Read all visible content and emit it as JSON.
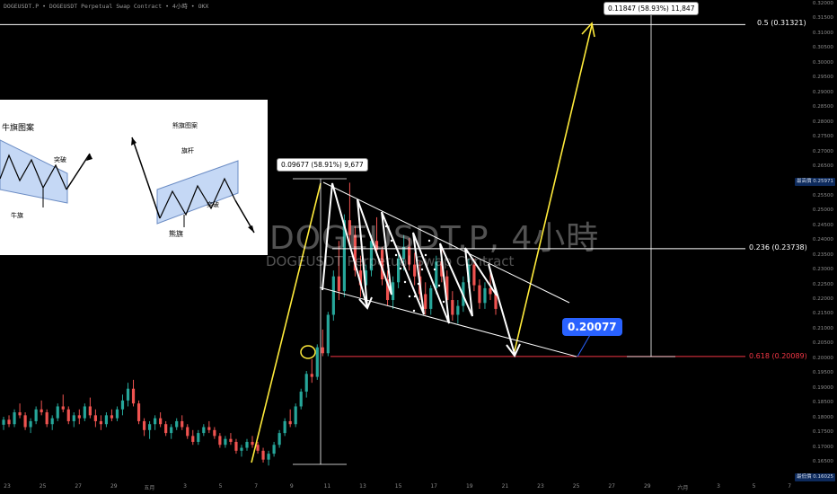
{
  "header": {
    "symbol": "DOGEUSDT.P",
    "contract": "DOGEUSDT Perpetual Swap Contract",
    "interval": "4小時",
    "exchange": "OKX",
    "separator": "•"
  },
  "watermark": {
    "line1": "DOGEUSDT.P, 4小時",
    "line2": "DOGEUSDT Perpetual Swap Contract"
  },
  "price_axis": {
    "ticks": [
      "0.32000",
      "0.31500",
      "0.31000",
      "0.30500",
      "0.30000",
      "0.29500",
      "0.29000",
      "0.28500",
      "0.28000",
      "0.27500",
      "0.27000",
      "0.26500",
      "0.26000",
      "0.25500",
      "0.25000",
      "0.24500",
      "0.24000",
      "0.23500",
      "0.23000",
      "0.22500",
      "0.22000",
      "0.21500",
      "0.21000",
      "0.20500",
      "0.20000",
      "0.19500",
      "0.19000",
      "0.18500",
      "0.18000",
      "0.17500",
      "0.17000",
      "0.16500"
    ],
    "high_badge": {
      "label": "最高價",
      "value": "0.25971"
    },
    "low_badge": {
      "label": "最低價",
      "value": "0.16025"
    }
  },
  "time_axis": {
    "ticks": [
      "23",
      "25",
      "27",
      "29",
      "五月",
      "3",
      "5",
      "7",
      "9",
      "11",
      "13",
      "15",
      "17",
      "19",
      "21",
      "23",
      "25",
      "27",
      "29",
      "六月",
      "3",
      "5",
      "7"
    ]
  },
  "fib_levels": [
    {
      "label": "0.5 (0.31321)",
      "price": 0.31321,
      "color": "#ffffff"
    },
    {
      "label": "0.236 (0.23738)",
      "price": 0.23738,
      "color": "#ffffff"
    },
    {
      "label": "0.618 (0.20089)",
      "price": 0.20089,
      "color": "#f23645"
    }
  ],
  "measurements": [
    {
      "text": "0.09677 (58.91%) 9,677"
    },
    {
      "text": "0.11847 (58.93%) 11,847"
    }
  ],
  "callout": {
    "text": "0.20077"
  },
  "inset": {
    "bull_title": "牛旗图案",
    "bear_title": "熊旗图案",
    "breakout_left": "突破",
    "bull_flag": "牛旗",
    "flagpole": "旗杆",
    "breakout_right": "突破",
    "bear_flag": "熊旗"
  },
  "colors": {
    "up": "#26a69a",
    "down": "#ef5350",
    "annotation": "#ffeb3b",
    "fib_red": "#f23645",
    "callout": "#2962ff"
  },
  "chart_data": {
    "type": "candlestick",
    "symbol": "DOGEUSDT.P",
    "timeframe": "4小時",
    "price_range": [
      0.16,
      0.32
    ],
    "candles_ohlc_approx": [
      [
        0.1778,
        0.1805,
        0.176,
        0.1795
      ],
      [
        0.1795,
        0.181,
        0.177,
        0.178
      ],
      [
        0.178,
        0.183,
        0.177,
        0.182
      ],
      [
        0.182,
        0.185,
        0.18,
        0.181
      ],
      [
        0.181,
        0.182,
        0.176,
        0.177
      ],
      [
        0.177,
        0.18,
        0.175,
        0.179
      ],
      [
        0.179,
        0.184,
        0.178,
        0.183
      ],
      [
        0.183,
        0.186,
        0.181,
        0.182
      ],
      [
        0.182,
        0.183,
        0.177,
        0.178
      ],
      [
        0.178,
        0.181,
        0.176,
        0.18
      ],
      [
        0.18,
        0.185,
        0.179,
        0.184
      ],
      [
        0.184,
        0.188,
        0.182,
        0.183
      ],
      [
        0.183,
        0.184,
        0.178,
        0.179
      ],
      [
        0.179,
        0.182,
        0.177,
        0.181
      ],
      [
        0.181,
        0.183,
        0.178,
        0.18
      ],
      [
        0.18,
        0.185,
        0.179,
        0.184
      ],
      [
        0.184,
        0.187,
        0.18,
        0.181
      ],
      [
        0.181,
        0.183,
        0.177,
        0.179
      ],
      [
        0.179,
        0.181,
        0.176,
        0.178
      ],
      [
        0.178,
        0.182,
        0.177,
        0.181
      ],
      [
        0.181,
        0.183,
        0.179,
        0.18
      ],
      [
        0.18,
        0.184,
        0.179,
        0.183
      ],
      [
        0.183,
        0.188,
        0.181,
        0.186
      ],
      [
        0.186,
        0.192,
        0.184,
        0.19
      ],
      [
        0.19,
        0.193,
        0.184,
        0.185
      ],
      [
        0.185,
        0.186,
        0.178,
        0.179
      ],
      [
        0.179,
        0.18,
        0.174,
        0.176
      ],
      [
        0.176,
        0.179,
        0.173,
        0.178
      ],
      [
        0.178,
        0.181,
        0.176,
        0.18
      ],
      [
        0.18,
        0.182,
        0.177,
        0.178
      ],
      [
        0.178,
        0.179,
        0.174,
        0.175
      ],
      [
        0.175,
        0.178,
        0.173,
        0.177
      ],
      [
        0.177,
        0.18,
        0.176,
        0.179
      ],
      [
        0.179,
        0.181,
        0.176,
        0.177
      ],
      [
        0.177,
        0.178,
        0.173,
        0.174
      ],
      [
        0.174,
        0.176,
        0.171,
        0.172
      ],
      [
        0.172,
        0.176,
        0.171,
        0.175
      ],
      [
        0.175,
        0.178,
        0.174,
        0.177
      ],
      [
        0.177,
        0.179,
        0.175,
        0.176
      ],
      [
        0.176,
        0.177,
        0.173,
        0.174
      ],
      [
        0.174,
        0.175,
        0.17,
        0.171
      ],
      [
        0.171,
        0.174,
        0.17,
        0.173
      ],
      [
        0.173,
        0.175,
        0.171,
        0.172
      ],
      [
        0.172,
        0.173,
        0.168,
        0.169
      ],
      [
        0.169,
        0.171,
        0.167,
        0.17
      ],
      [
        0.17,
        0.173,
        0.169,
        0.172
      ],
      [
        0.172,
        0.174,
        0.17,
        0.171
      ],
      [
        0.171,
        0.172,
        0.168,
        0.169
      ],
      [
        0.169,
        0.17,
        0.165,
        0.166
      ],
      [
        0.166,
        0.169,
        0.164,
        0.168
      ],
      [
        0.168,
        0.172,
        0.167,
        0.171
      ],
      [
        0.171,
        0.176,
        0.17,
        0.175
      ],
      [
        0.175,
        0.18,
        0.174,
        0.179
      ],
      [
        0.179,
        0.183,
        0.177,
        0.178
      ],
      [
        0.178,
        0.185,
        0.177,
        0.184
      ],
      [
        0.184,
        0.19,
        0.183,
        0.189
      ],
      [
        0.189,
        0.196,
        0.187,
        0.195
      ],
      [
        0.195,
        0.2,
        0.192,
        0.194
      ],
      [
        0.194,
        0.205,
        0.193,
        0.204
      ],
      [
        0.204,
        0.21,
        0.201,
        0.202
      ],
      [
        0.202,
        0.216,
        0.201,
        0.215
      ],
      [
        0.215,
        0.23,
        0.213,
        0.228
      ],
      [
        0.228,
        0.24,
        0.22,
        0.223
      ],
      [
        0.223,
        0.249,
        0.221,
        0.247
      ],
      [
        0.247,
        0.2597,
        0.238,
        0.242
      ],
      [
        0.242,
        0.245,
        0.228,
        0.23
      ],
      [
        0.23,
        0.235,
        0.221,
        0.225
      ],
      [
        0.225,
        0.232,
        0.22,
        0.23
      ],
      [
        0.23,
        0.242,
        0.228,
        0.24
      ],
      [
        0.24,
        0.248,
        0.235,
        0.237
      ],
      [
        0.237,
        0.238,
        0.225,
        0.227
      ],
      [
        0.227,
        0.23,
        0.218,
        0.22
      ],
      [
        0.22,
        0.228,
        0.217,
        0.226
      ],
      [
        0.226,
        0.236,
        0.224,
        0.234
      ],
      [
        0.234,
        0.242,
        0.23,
        0.238
      ],
      [
        0.238,
        0.241,
        0.23,
        0.232
      ],
      [
        0.232,
        0.236,
        0.225,
        0.228
      ],
      [
        0.228,
        0.233,
        0.22,
        0.222
      ],
      [
        0.222,
        0.226,
        0.215,
        0.217
      ],
      [
        0.217,
        0.225,
        0.215,
        0.224
      ],
      [
        0.224,
        0.235,
        0.222,
        0.233
      ],
      [
        0.233,
        0.238,
        0.226,
        0.228
      ],
      [
        0.228,
        0.23,
        0.218,
        0.22
      ],
      [
        0.22,
        0.223,
        0.213,
        0.215
      ],
      [
        0.215,
        0.22,
        0.212,
        0.218
      ],
      [
        0.218,
        0.228,
        0.216,
        0.226
      ],
      [
        0.226,
        0.234,
        0.224,
        0.232
      ],
      [
        0.232,
        0.234,
        0.223,
        0.225
      ],
      [
        0.225,
        0.227,
        0.217,
        0.219
      ],
      [
        0.219,
        0.226,
        0.217,
        0.224
      ],
      [
        0.224,
        0.23,
        0.22,
        0.222
      ],
      [
        0.222,
        0.224,
        0.215,
        0.217
      ]
    ],
    "annotations": [
      "descending flag channel",
      "projected breakdown to 0.20077",
      "projected breakout target 0.31321"
    ]
  }
}
